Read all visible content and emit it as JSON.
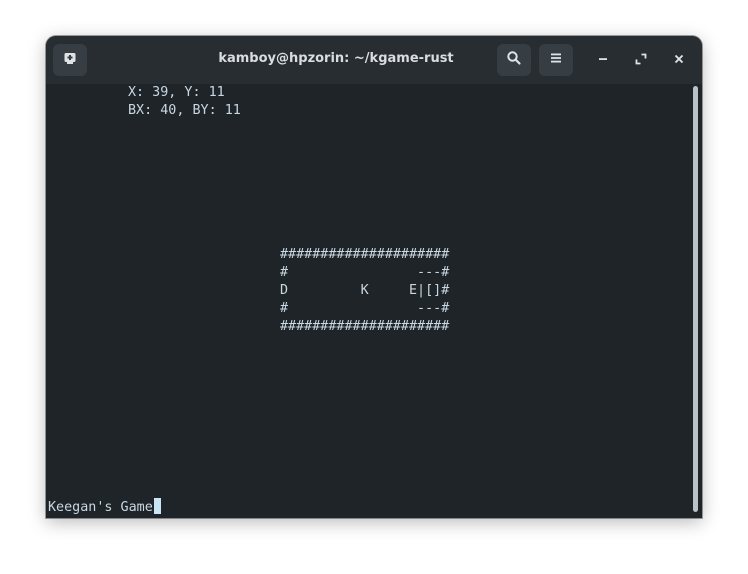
{
  "window": {
    "title": "kamboy@hpzorin: ~/kgame-rust",
    "colors": {
      "background": "#1e2427",
      "titlebar": "#272d31",
      "text": "#c9d7e2",
      "cursor": "#c9e6f7"
    }
  },
  "toolbar": {
    "new_tab_icon": "new-tab-icon",
    "search_icon": "search-icon",
    "menu_icon": "hamburger-menu-icon",
    "minimize_icon": "minimize-icon",
    "maximize_icon": "maximize-icon",
    "close_icon": "close-icon"
  },
  "terminal": {
    "coords_line": "X: 39, Y: 11",
    "box_coords_line": "BX: 40, BY: 11",
    "board": [
      "#####################",
      "#                ---#",
      "D         K     E|[]#",
      "#                ---#",
      "#####################"
    ],
    "prompt_text": "Keegan's Game"
  }
}
